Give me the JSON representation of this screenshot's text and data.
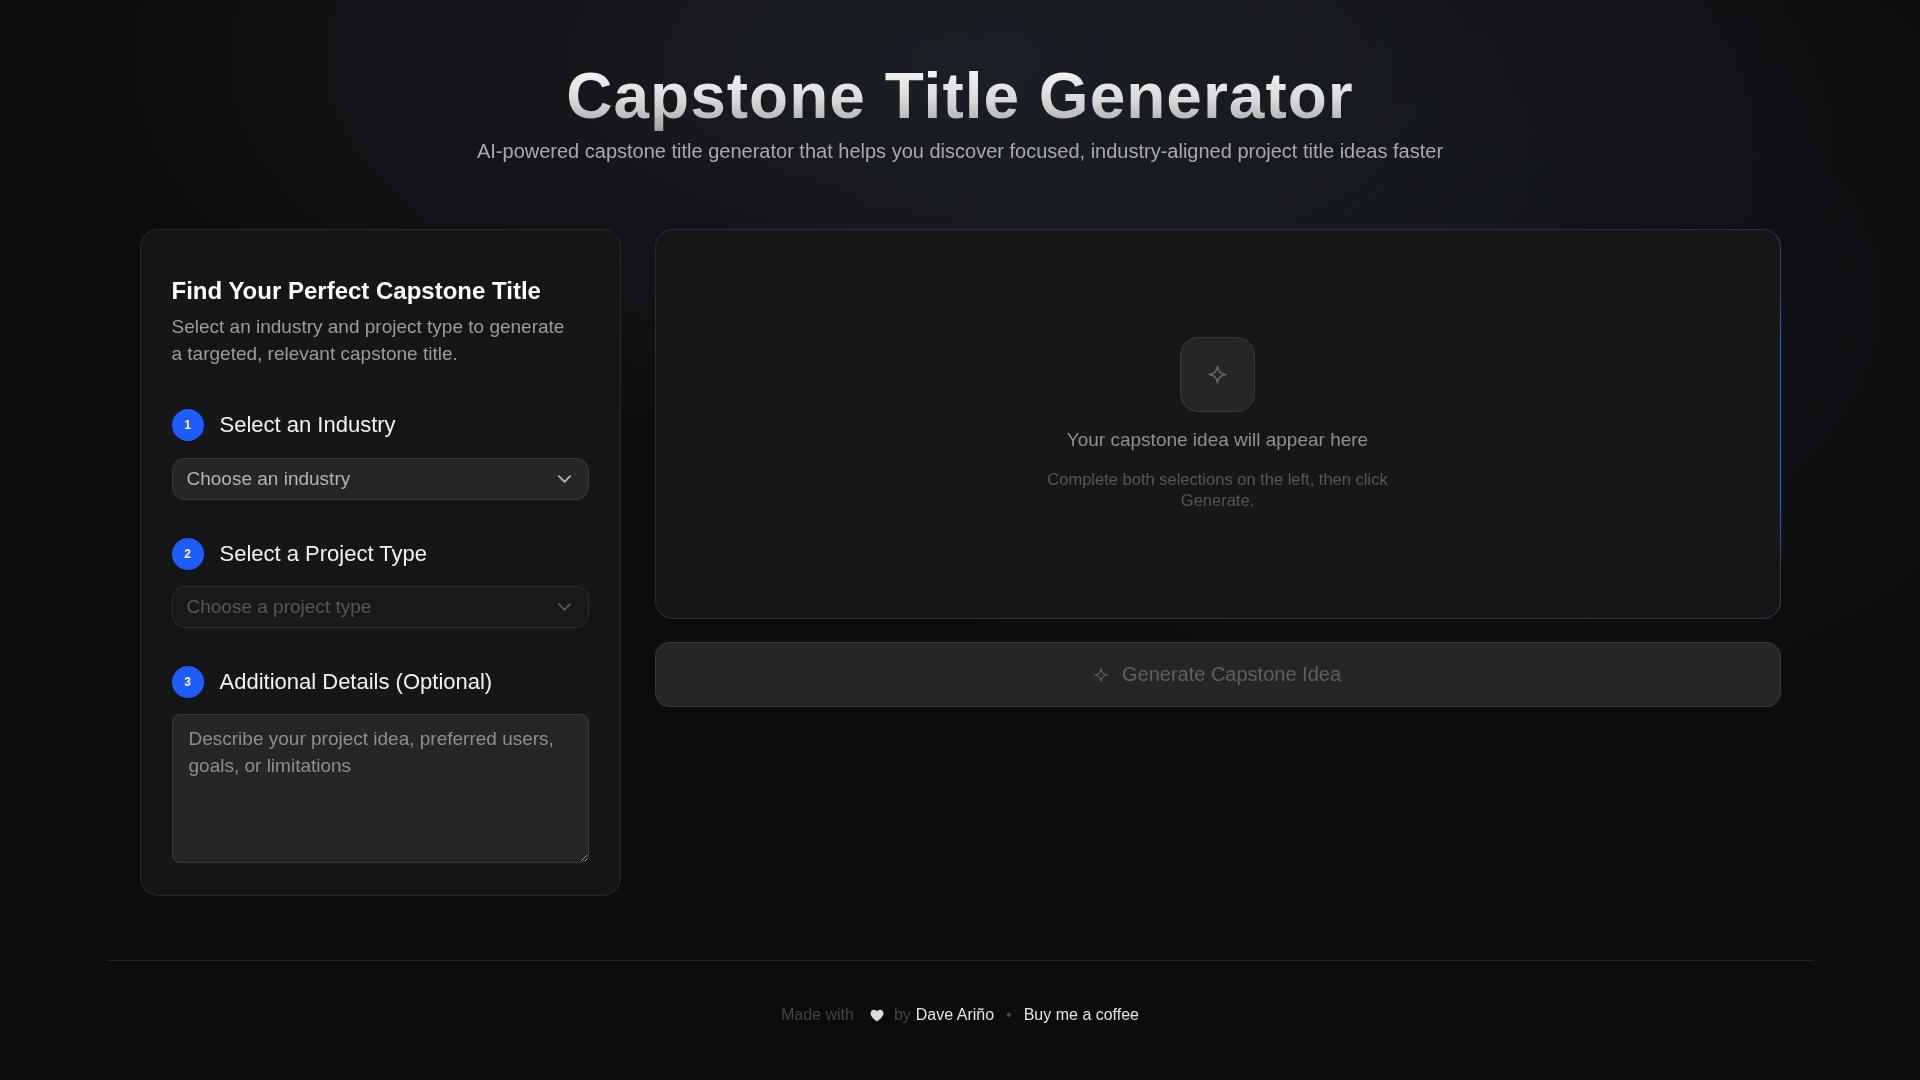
{
  "header": {
    "title": "Capstone Title Generator",
    "subtitle": "AI-powered capstone title generator that helps you discover focused, industry-aligned project title ideas faster"
  },
  "form": {
    "title": "Find Your Perfect Capstone Title",
    "description": "Select an industry and project type to generate a targeted, relevant capstone title.",
    "steps": [
      {
        "number": "1",
        "label": "Select an Industry",
        "kind": "select",
        "placeholder": "Choose an industry",
        "disabled": false
      },
      {
        "number": "2",
        "label": "Select a Project Type",
        "kind": "select",
        "placeholder": "Choose a project type",
        "disabled": true
      },
      {
        "number": "3",
        "label": "Additional Details (Optional)",
        "kind": "textarea",
        "placeholder": "Describe your project idea, preferred users, goals, or limitations",
        "disabled": false
      }
    ]
  },
  "result": {
    "title": "Your capstone idea will appear here",
    "hint": "Complete both selections on the left, then click Generate."
  },
  "generate_button": {
    "label": "Generate Capstone Idea",
    "disabled": true
  },
  "footer": {
    "made_with": "Made with",
    "by": "by",
    "author_link": "Dave Ariño",
    "separator": "•",
    "coffee_link": "Buy me a coffee"
  }
}
